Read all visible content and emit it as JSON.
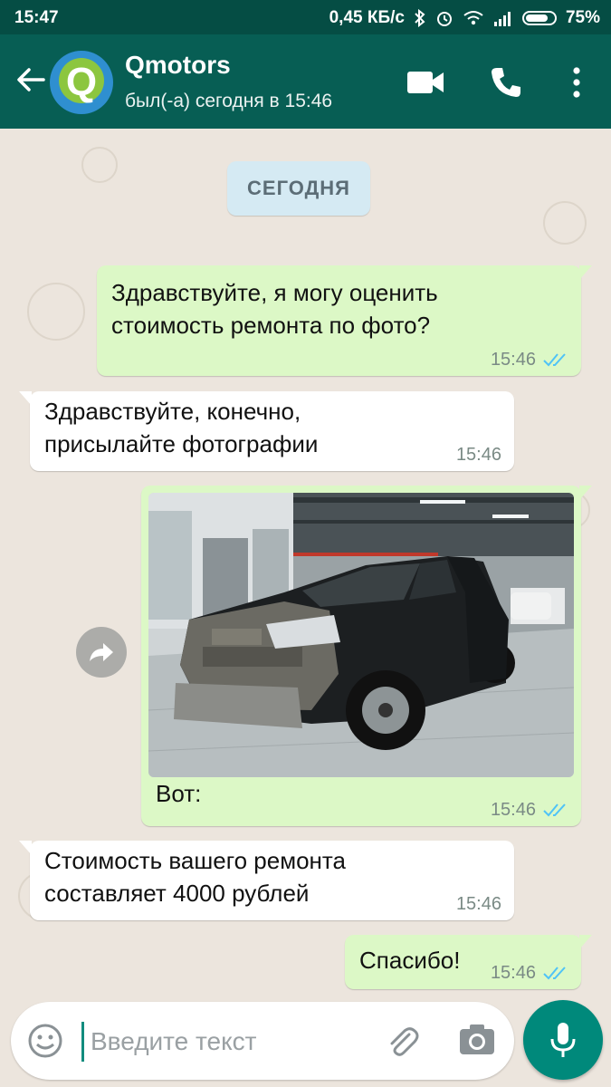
{
  "status_bar": {
    "time": "15:47",
    "net_speed": "0,45 КБ/с",
    "battery": "75%",
    "icons": [
      "bluetooth-icon",
      "alarm-icon",
      "wifi-icon",
      "signal-icon",
      "battery-icon"
    ]
  },
  "header": {
    "contact_name": "Qmotors",
    "avatar_letter": "Q",
    "last_seen": "был(-а) сегодня в 15:46",
    "icons": [
      "back-arrow-icon",
      "video-call-icon",
      "phone-icon",
      "more-vert-icon"
    ]
  },
  "chat": {
    "date_label": "СЕГОДНЯ",
    "messages": [
      {
        "direction": "outgoing",
        "text": "Здравствуйте, я могу оценить\nстоимость ремонта по фото?",
        "time": "15:46",
        "read": true
      },
      {
        "direction": "incoming",
        "text": "Здравствуйте, конечно,\nприсылайте фотографии",
        "time": "15:46"
      },
      {
        "direction": "outgoing",
        "type": "image",
        "image": "damaged black SUV in repair shop",
        "caption": "Вот:",
        "time": "15:46",
        "read": true
      },
      {
        "direction": "incoming",
        "text": "Стоимость вашего ремонта\nсоставляет 4000 рублей",
        "time": "15:46"
      },
      {
        "direction": "outgoing",
        "text": "Спасибо!",
        "time": "15:46",
        "read": true
      }
    ]
  },
  "composer": {
    "placeholder": "Введите текст",
    "value": "",
    "icons": [
      "emoji-icon",
      "attach-icon",
      "camera-icon",
      "mic-icon"
    ]
  },
  "colors": {
    "status_bar": "#054d44",
    "app_bar": "#075e54",
    "outgoing_bubble": "#dcf8c6",
    "incoming_bubble": "#ffffff",
    "read_ticks": "#4fc3f7",
    "mic_button": "#00897b",
    "chat_background": "#ece5dd"
  }
}
